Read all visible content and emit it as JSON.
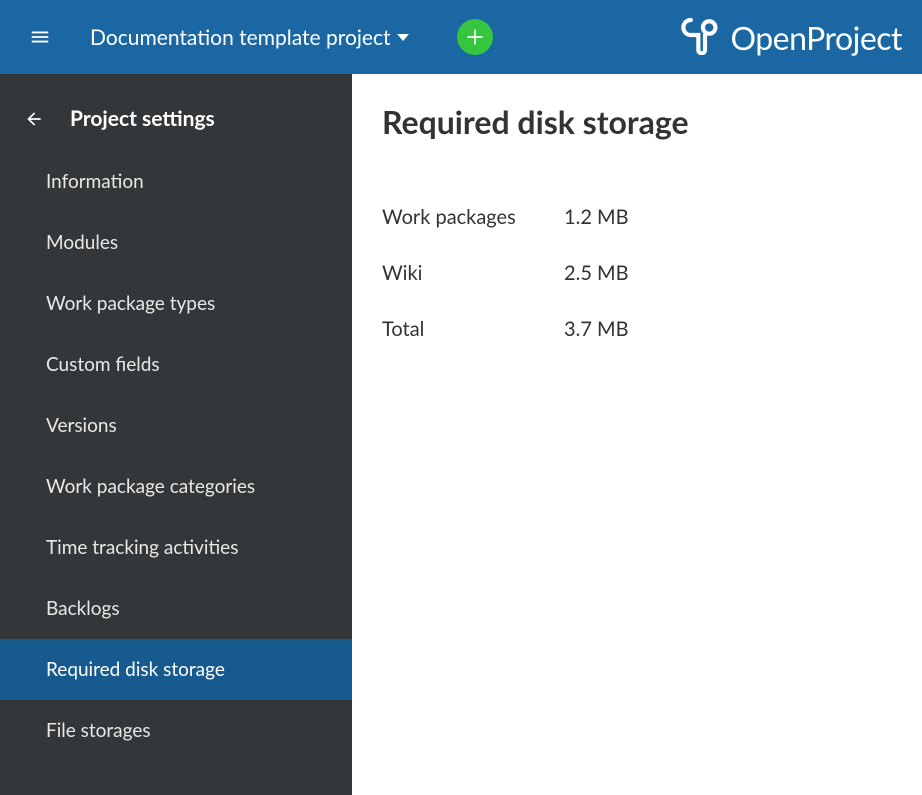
{
  "header": {
    "project_name": "Documentation template project",
    "logo_text": "OpenProject"
  },
  "sidebar": {
    "title": "Project settings",
    "items": [
      {
        "label": "Information",
        "active": false
      },
      {
        "label": "Modules",
        "active": false
      },
      {
        "label": "Work package types",
        "active": false
      },
      {
        "label": "Custom fields",
        "active": false
      },
      {
        "label": "Versions",
        "active": false
      },
      {
        "label": "Work package categories",
        "active": false
      },
      {
        "label": "Time tracking activities",
        "active": false
      },
      {
        "label": "Backlogs",
        "active": false
      },
      {
        "label": "Required disk storage",
        "active": true
      },
      {
        "label": "File storages",
        "active": false
      }
    ]
  },
  "main": {
    "heading": "Required disk storage",
    "rows": [
      {
        "label": "Work packages",
        "value": "1.2 MB"
      },
      {
        "label": "Wiki",
        "value": "2.5 MB"
      },
      {
        "label": "Total",
        "value": "3.7 MB"
      }
    ]
  }
}
